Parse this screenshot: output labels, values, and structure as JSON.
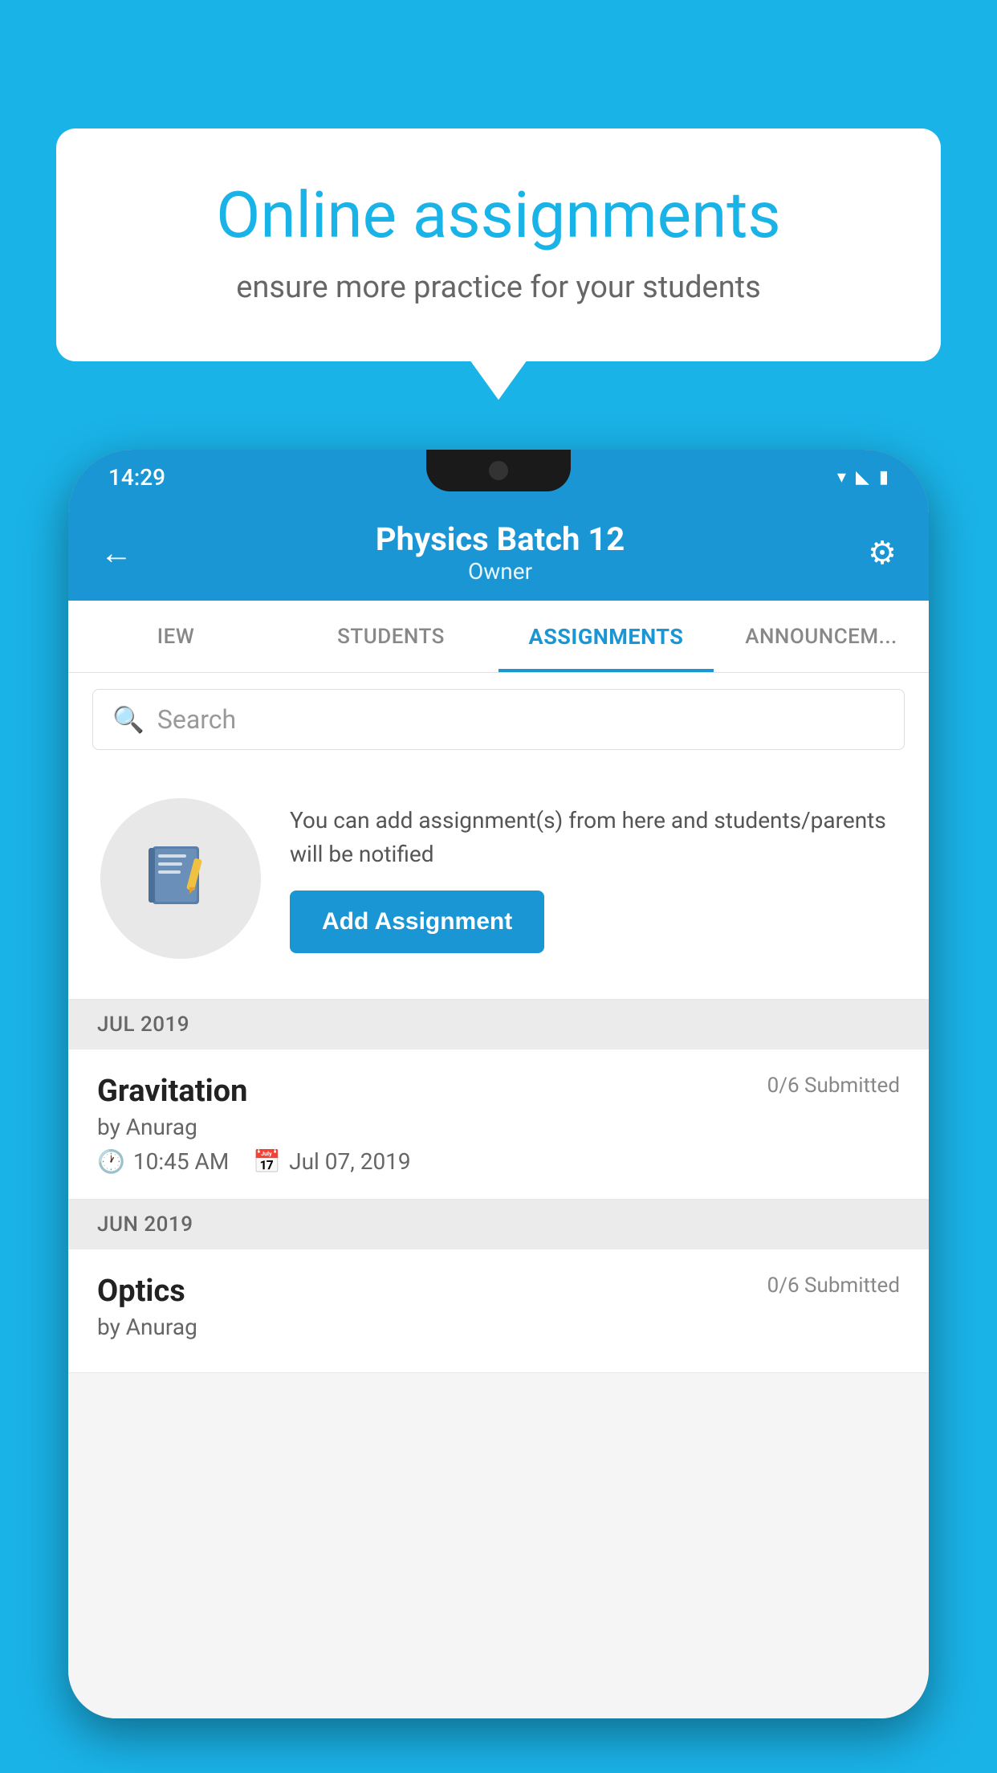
{
  "background_color": "#1ab3e8",
  "speech_bubble": {
    "title": "Online assignments",
    "subtitle": "ensure more practice for your students"
  },
  "status_bar": {
    "time": "14:29",
    "icons": [
      "wifi",
      "signal",
      "battery"
    ]
  },
  "header": {
    "title": "Physics Batch 12",
    "subtitle": "Owner",
    "back_label": "←",
    "settings_label": "⚙"
  },
  "tabs": [
    {
      "label": "IEW",
      "active": false
    },
    {
      "label": "STUDENTS",
      "active": false
    },
    {
      "label": "ASSIGNMENTS",
      "active": true
    },
    {
      "label": "ANNOUNCEM...",
      "active": false
    }
  ],
  "search": {
    "placeholder": "Search"
  },
  "promo": {
    "description": "You can add assignment(s) from here and students/parents will be notified",
    "button_label": "Add Assignment"
  },
  "sections": [
    {
      "header": "JUL 2019",
      "assignments": [
        {
          "title": "Gravitation",
          "submitted": "0/6 Submitted",
          "author": "by Anurag",
          "time": "10:45 AM",
          "date": "Jul 07, 2019"
        }
      ]
    },
    {
      "header": "JUN 2019",
      "assignments": [
        {
          "title": "Optics",
          "submitted": "0/6 Submitted",
          "author": "by Anurag",
          "time": "",
          "date": ""
        }
      ]
    }
  ]
}
